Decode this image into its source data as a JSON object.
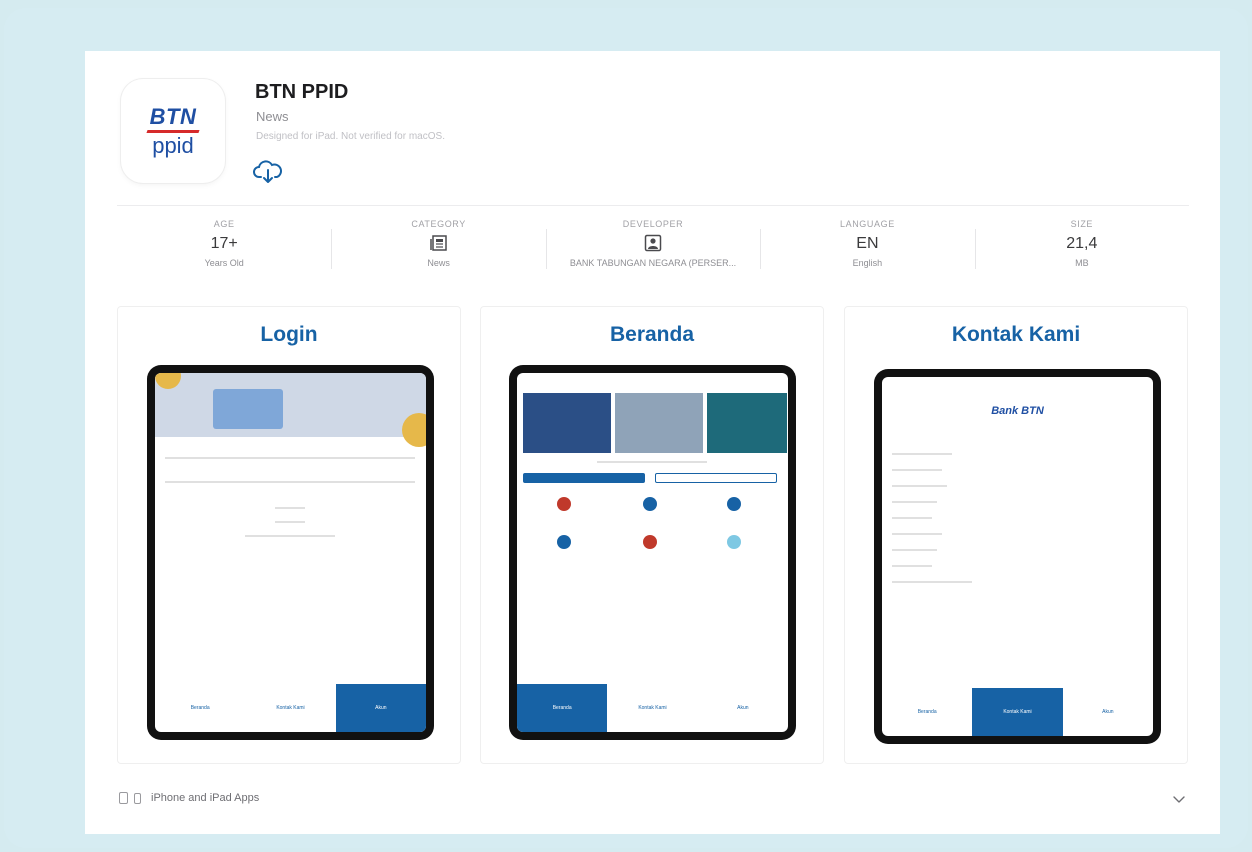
{
  "app": {
    "name": "BTN PPID",
    "category_sub": "News",
    "note": "Designed for iPad. Not verified for macOS.",
    "logo_top": "BTN",
    "logo_bottom": "ppid"
  },
  "info": [
    {
      "label": "AGE",
      "value": "17+",
      "foot": "Years Old"
    },
    {
      "label": "CATEGORY",
      "value": "",
      "foot": "News",
      "icon": "newspaper-icon"
    },
    {
      "label": "DEVELOPER",
      "value": "",
      "foot": "BANK TABUNGAN NEGARA (PERSER...",
      "icon": "person-icon"
    },
    {
      "label": "LANGUAGE",
      "value": "EN",
      "foot": "English"
    },
    {
      "label": "SIZE",
      "value": "21,4",
      "foot": "MB"
    }
  ],
  "screenshots": [
    {
      "title": "Login",
      "tabs": [
        "Beranda",
        "Kontak Kami",
        "Akun"
      ],
      "active": 2
    },
    {
      "title": "Beranda",
      "tabs": [
        "Beranda",
        "Kontak Kami",
        "Akun"
      ],
      "active": 0
    },
    {
      "title": "Kontak Kami",
      "tabs": [
        "Beranda",
        "Kontak Kami",
        "Akun"
      ],
      "active": 1,
      "brand": "Bank BTN"
    }
  ],
  "footer": {
    "text": "iPhone and iPad Apps"
  },
  "colors": {
    "accent": "#1762a5",
    "background": "#d6ecf2"
  }
}
